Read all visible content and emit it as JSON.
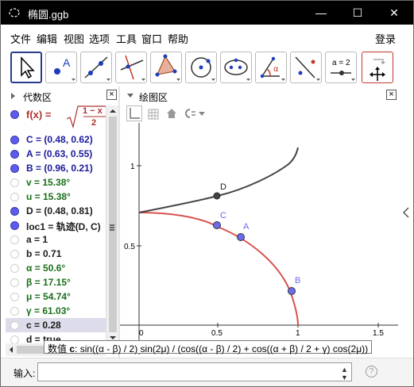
{
  "window": {
    "title": "椭圆.ggb",
    "minimize_label": "—",
    "maximize_label": "☐",
    "close_label": "✕"
  },
  "menu": {
    "items": [
      "文件",
      "编辑",
      "视图",
      "选项",
      "工具",
      "窗口",
      "帮助"
    ],
    "login": "登录"
  },
  "toolbar": {
    "tools": [
      {
        "name": "move-tool",
        "icon": "arrow-cursor-icon"
      },
      {
        "name": "point-tool",
        "icon": "point-A-icon",
        "text": "A"
      },
      {
        "name": "line-tool",
        "icon": "line-through-points-icon"
      },
      {
        "name": "perpendicular-line-tool",
        "icon": "perpendicular-icon"
      },
      {
        "name": "polygon-tool",
        "icon": "triangle-icon"
      },
      {
        "name": "circle-tool",
        "icon": "circle-center-point-icon"
      },
      {
        "name": "ellipse-tool",
        "icon": "ellipse-icon"
      },
      {
        "name": "angle-tool",
        "icon": "angle-icon",
        "text": "α"
      },
      {
        "name": "reflect-tool",
        "icon": "reflect-line-icon"
      },
      {
        "name": "slider-tool",
        "icon": "slider-icon",
        "text": "a = 2"
      },
      {
        "name": "move-graphics-tool",
        "icon": "move-graphics-icon"
      }
    ]
  },
  "algebra": {
    "title": "代数区",
    "formula": "f(x) = √((1 − x²)/2)",
    "formula_parts": {
      "lhs": "f(x) = ",
      "num": "1 − x",
      "den": "2"
    },
    "rows": [
      {
        "text": "C = (0.48, 0.62)",
        "color": "#1a1a9c",
        "visible": true
      },
      {
        "text": "A = (0.63, 0.55)",
        "color": "#1a1a9c",
        "visible": true
      },
      {
        "text": "B = (0.96, 0.21)",
        "color": "#1a1a9c",
        "visible": true
      },
      {
        "text": "v = 15.38°",
        "color": "#1a6e1a",
        "visible": false
      },
      {
        "text": "u = 15.38°",
        "color": "#1a6e1a",
        "visible": false
      },
      {
        "text": "D = (0.48, 0.81)",
        "color": "#1a1a1a",
        "visible": true
      },
      {
        "text": "loc1 = 轨迹(D, C)",
        "color": "#1a1a1a",
        "visible": true
      },
      {
        "text": "a = 1",
        "color": "#1a1a1a",
        "visible": false
      },
      {
        "text": "b = 0.71",
        "color": "#1a1a1a",
        "visible": false
      },
      {
        "text": "α = 50.6°",
        "color": "#1a6e1a",
        "visible": false
      },
      {
        "text": "β = 17.15°",
        "color": "#1a6e1a",
        "visible": false
      },
      {
        "text": "μ = 54.74°",
        "color": "#1a6e1a",
        "visible": false
      },
      {
        "text": "γ = 61.03°",
        "color": "#1a6e1a",
        "visible": false
      },
      {
        "text": "c = 0.28",
        "color": "#1a1a1a",
        "visible": false,
        "selected": true
      },
      {
        "text": "d = true",
        "color": "#1a1a1a",
        "visible": false
      }
    ]
  },
  "graphics": {
    "title": "绘图区",
    "x_ticks": [
      "0",
      "0.5",
      "1",
      "1.5"
    ],
    "y_ticks": [
      "1",
      "0.5"
    ],
    "point_labels": {
      "A": "A",
      "B": "B",
      "C": "C",
      "D": "D"
    },
    "colors": {
      "ellipse": "#d9534f",
      "locus": "#444444",
      "point": "#6b6bf0"
    }
  },
  "tooltip": {
    "prefix": "数值",
    "name": "c",
    "definition": ": sin((α - β) / 2) sin(2μ) / (cos((α - β) / 2) + cos((α + β) / 2 + γ) cos(2μ))"
  },
  "input": {
    "label": "输入:",
    "value": "",
    "help": "?"
  }
}
